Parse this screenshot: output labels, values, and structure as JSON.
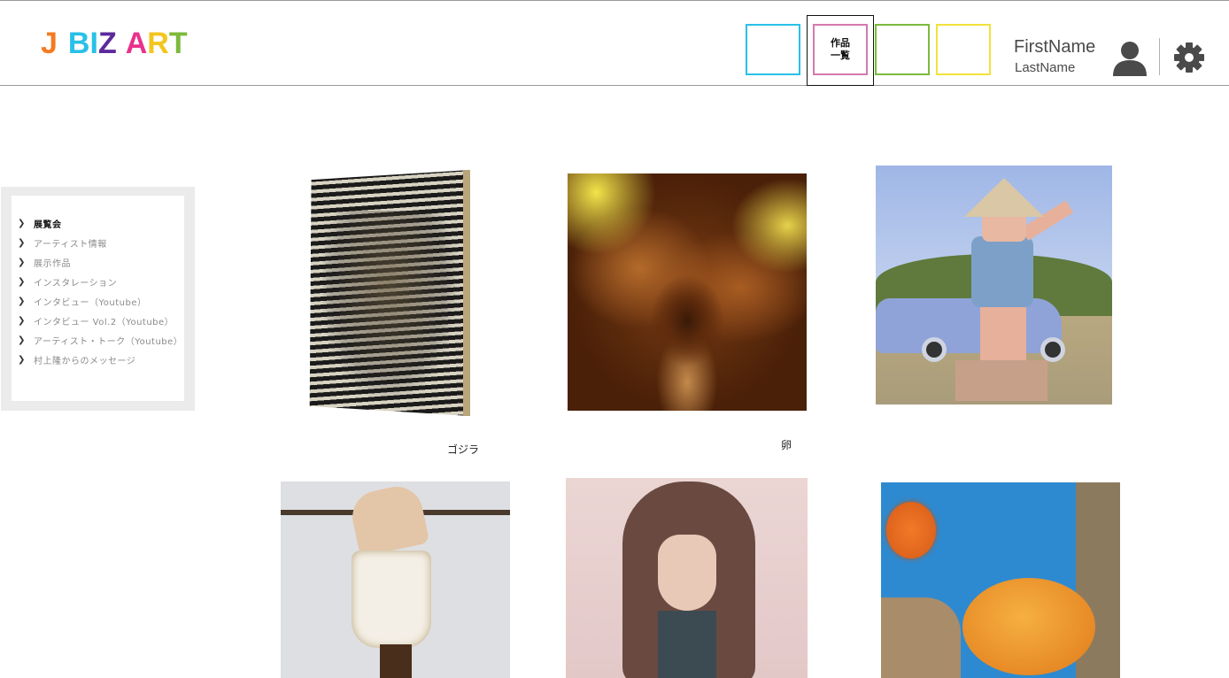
{
  "header": {
    "logo": [
      {
        "char": "J",
        "color": "#f47b20"
      },
      {
        "char": " ",
        "color": "#ffffff"
      },
      {
        "char": "B",
        "color": "#29c0e8"
      },
      {
        "char": "I",
        "color": "#29c0e8"
      },
      {
        "char": "Z",
        "color": "#5b2a9c"
      },
      {
        "char": " ",
        "color": "#ffffff"
      },
      {
        "char": "A",
        "color": "#e8328c"
      },
      {
        "char": "R",
        "color": "#f2c61f"
      },
      {
        "char": "T",
        "color": "#7cba3c"
      }
    ],
    "nav": {
      "box1_color": "#29c0e8",
      "active_line1": "作品",
      "active_line2": "一覧",
      "active_color": "#d679ad",
      "box3_color": "#7cba3c",
      "box4_color": "#f2e23a"
    },
    "user": {
      "first_name": "FirstName",
      "last_name": "LastName",
      "avatar_icon": "user-icon"
    },
    "settings_icon": "gear-icon"
  },
  "sidebar": {
    "items": [
      {
        "label": "展覧会",
        "active": true
      },
      {
        "label": "アーティスト情報",
        "active": false
      },
      {
        "label": "展示作品",
        "active": false
      },
      {
        "label": "インスタレーション",
        "active": false
      },
      {
        "label": "インタビュー（Youtube）",
        "active": false
      },
      {
        "label": "インタビュー Vol.2（Youtube）",
        "active": false
      },
      {
        "label": "アーティスト・トーク（Youtube）",
        "active": false
      },
      {
        "label": "村上隆からのメッセージ",
        "active": false
      }
    ]
  },
  "gallery": {
    "items": [
      {
        "caption": "ゴジラ"
      },
      {
        "caption": "卵"
      },
      {
        "caption": ""
      },
      {
        "caption": ""
      },
      {
        "caption": ""
      },
      {
        "caption": ""
      }
    ]
  }
}
